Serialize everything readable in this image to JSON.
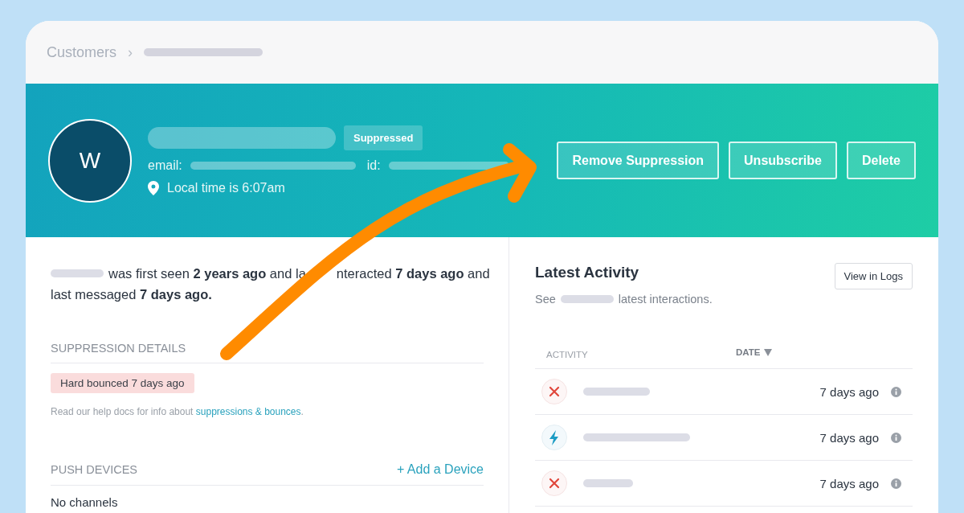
{
  "breadcrumb": {
    "root": "Customers",
    "separator": "›"
  },
  "profile": {
    "initial": "W",
    "status_badge": "Suppressed",
    "email_label": "email:",
    "id_label": "id:",
    "local_time": "Local time is 6:07am"
  },
  "actions": [
    "Remove Suppression",
    "Unsubscribe",
    "Delete"
  ],
  "summary": [
    "was first seen **2 years ago** and la",
    "nteracted **7 days ago** and",
    "last messaged **7 days ago.**"
  ],
  "suppression": {
    "heading": "SUPPRESSION DETAILS",
    "badge": "Hard bounced 7 days ago",
    "help_text": "Read our help docs for info about ",
    "help_link": "suppressions & bounces",
    "help_end": "."
  },
  "push_devices": {
    "heading": "PUSH DEVICES",
    "add_link": "+ Add a Device",
    "empty": "No channels"
  },
  "activity": {
    "title": "Latest Activity",
    "view_button": "View in Logs",
    "subtitle_prefix": "See",
    "subtitle_suffix": "latest interactions.",
    "columns": [
      {
        "label": "ACTIVITY",
        "sorted": false
      },
      {
        "label": "DATE",
        "sorted": true
      }
    ],
    "rows": [
      {
        "kind": "failed",
        "date": "7 days ago"
      },
      {
        "kind": "event",
        "date": "7 days ago"
      },
      {
        "kind": "failed",
        "date": "7 days ago"
      }
    ]
  }
}
